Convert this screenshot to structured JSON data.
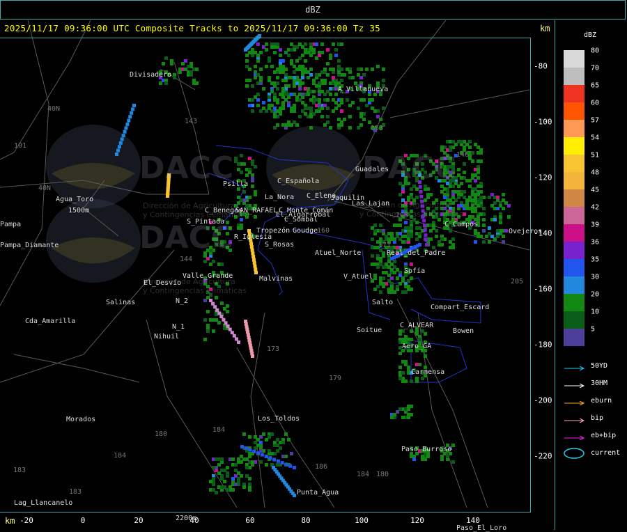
{
  "window": {
    "title": "dBZ"
  },
  "header": {
    "text": "2025/11/17 09:36:00 UTC Composite Tracks to 2025/11/17 09:36:00 Tz 35",
    "km_top": "km",
    "km_bottom": "km"
  },
  "axes": {
    "x_ticks": [
      "-20",
      "0",
      "20",
      "40",
      "60",
      "80",
      "100",
      "120",
      "140"
    ],
    "y_ticks": [
      "-80",
      "-100",
      "-120",
      "-140",
      "-160",
      "-180",
      "-200",
      "-220"
    ]
  },
  "legend": {
    "title": "dBZ",
    "scale": [
      {
        "value": "80",
        "color": "#d9d9d9"
      },
      {
        "value": "70",
        "color": "#bdbdbd"
      },
      {
        "value": "65",
        "color": "#ee3322"
      },
      {
        "value": "60",
        "color": "#ff5500"
      },
      {
        "value": "57",
        "color": "#ff9955"
      },
      {
        "value": "54",
        "color": "#ffee00"
      },
      {
        "value": "51",
        "color": "#f7c531"
      },
      {
        "value": "48",
        "color": "#f2b43a"
      },
      {
        "value": "45",
        "color": "#cc8844"
      },
      {
        "value": "42",
        "color": "#cc6699"
      },
      {
        "value": "39",
        "color": "#cc1188"
      },
      {
        "value": "36",
        "color": "#7722cc"
      },
      {
        "value": "35",
        "color": "#2255ee"
      },
      {
        "value": "30",
        "color": "#2288dd"
      },
      {
        "value": "20",
        "color": "#118811"
      },
      {
        "value": "10",
        "color": "#0b5e1a"
      },
      {
        "value": "5",
        "color": "#4b3f99"
      }
    ],
    "tracks": [
      {
        "label": "50YD",
        "color": "#22ccee"
      },
      {
        "label": "30HM",
        "color": "#ffffff"
      },
      {
        "label": "eburn",
        "color": "#ffaa22"
      },
      {
        "label": "bip",
        "color": "#ffaacc"
      },
      {
        "label": "eb+bip",
        "color": "#ee22ee"
      },
      {
        "label": "current",
        "color": "#22ccee"
      }
    ]
  },
  "places": [
    {
      "name": "Divisadero"
    },
    {
      "name": "A_Villanueva"
    },
    {
      "name": "Guadales"
    },
    {
      "name": "Psilla"
    },
    {
      "name": "La_Nora"
    },
    {
      "name": "C_Española"
    },
    {
      "name": "C_Elena"
    },
    {
      "name": "Jaquilin"
    },
    {
      "name": "Las_Lajan"
    },
    {
      "name": "Agua_Toro"
    },
    {
      "name": "1500m"
    },
    {
      "name": "C_Benegas"
    },
    {
      "name": "SAN_RAFAEL"
    },
    {
      "name": "C_Monte_Comán"
    },
    {
      "name": "El_Algarrobal"
    },
    {
      "name": "S_Pintada"
    },
    {
      "name": "Tropezón"
    },
    {
      "name": "C_Sombal"
    },
    {
      "name": "Goudge"
    },
    {
      "name": "R_Iglesia"
    },
    {
      "name": "S_Rosas"
    },
    {
      "name": "Atuel_Norte"
    },
    {
      "name": "Pampa_Diamante"
    },
    {
      "name": "Ovejeros"
    },
    {
      "name": "C_Campos"
    },
    {
      "name": "Real_del_Padre"
    },
    {
      "name": "El_Desvío"
    },
    {
      "name": "Valle_Grande"
    },
    {
      "name": "Malvinas"
    },
    {
      "name": "V_Atuel"
    },
    {
      "name": "Salinas"
    },
    {
      "name": "N_2"
    },
    {
      "name": "N_1"
    },
    {
      "name": "Cda_Amarilla"
    },
    {
      "name": "Nihuil"
    },
    {
      "name": "Soitue"
    },
    {
      "name": "Compart_Escard"
    },
    {
      "name": "Bowen"
    },
    {
      "name": "C_ALVEAR"
    },
    {
      "name": "Aero_GA"
    },
    {
      "name": "Carmensa"
    },
    {
      "name": "Morados"
    },
    {
      "name": "Los_Toldos"
    },
    {
      "name": "Paso_Burroso"
    },
    {
      "name": "Punta_Agua"
    },
    {
      "name": "Lag_Llancanelo"
    },
    {
      "name": "Paso_El_Loro"
    },
    {
      "name": "2200m"
    },
    {
      "name": "Salto"
    },
    {
      "name": "Sofía"
    },
    {
      "name": "Pampa"
    }
  ],
  "watermarks": [
    {
      "text": "DACC"
    },
    {
      "text": "Dirección de Agricultura"
    },
    {
      "text": "y Contingencias Climáticas"
    }
  ],
  "route_numbers": [
    "143",
    "146",
    "40N",
    "101",
    "40N",
    "153",
    "203",
    "160",
    "171",
    "144",
    "205",
    "173",
    "179",
    "184",
    "180",
    "186",
    "184",
    "183",
    "183",
    "184",
    "180"
  ]
}
